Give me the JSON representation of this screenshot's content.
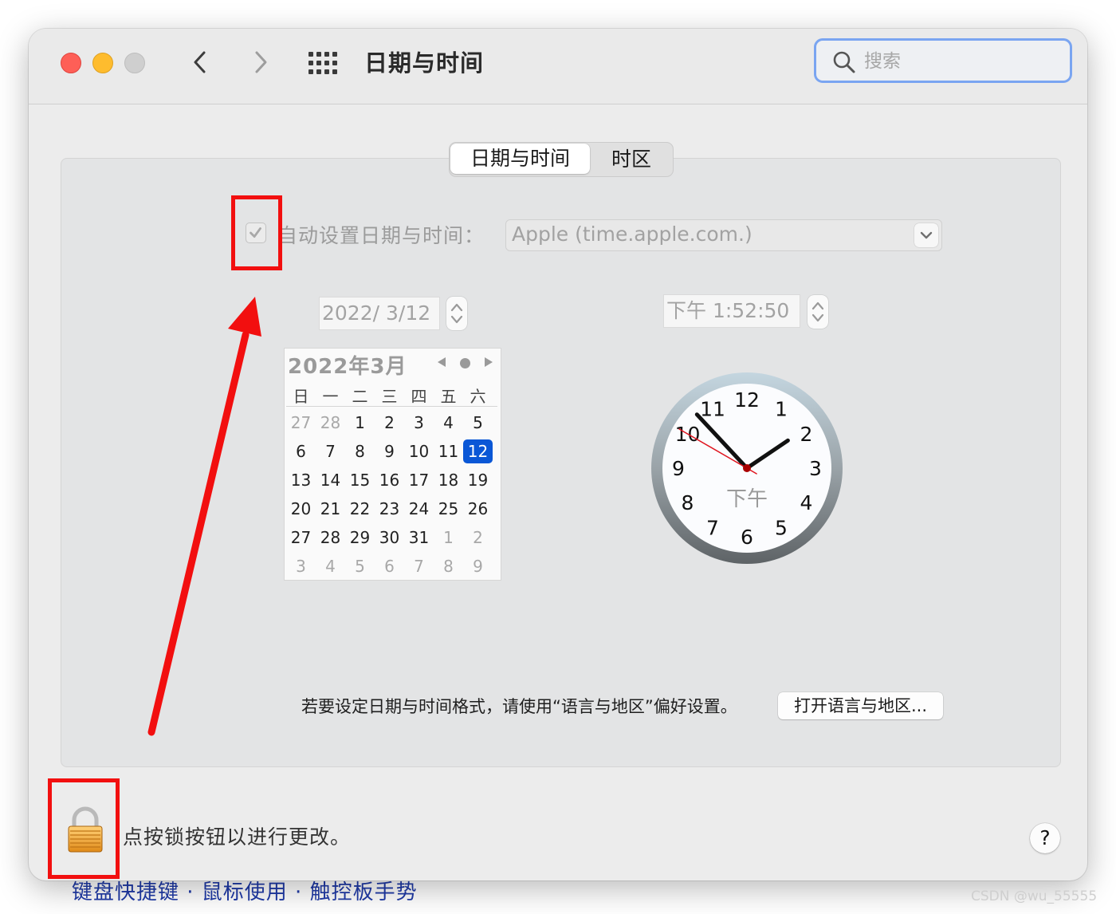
{
  "window": {
    "title": "日期与时间",
    "search_placeholder": "搜索"
  },
  "tabs": {
    "date_time": "日期与时间",
    "time_zone": "时区",
    "active": "日期与时间"
  },
  "auto": {
    "label": "自动设置日期与时间：",
    "checked": true,
    "server": "Apple (time.apple.com.)"
  },
  "date_field": {
    "value": "2022/  3/12"
  },
  "time_field": {
    "value": "下午   1:52:50"
  },
  "calendar": {
    "title": "2022年3月",
    "weekdays": [
      "日",
      "一",
      "二",
      "三",
      "四",
      "五",
      "六"
    ],
    "rows": [
      [
        {
          "d": "27",
          "m": true
        },
        {
          "d": "28",
          "m": true
        },
        {
          "d": "1"
        },
        {
          "d": "2"
        },
        {
          "d": "3"
        },
        {
          "d": "4"
        },
        {
          "d": "5"
        }
      ],
      [
        {
          "d": "6"
        },
        {
          "d": "7"
        },
        {
          "d": "8"
        },
        {
          "d": "9"
        },
        {
          "d": "10"
        },
        {
          "d": "11"
        },
        {
          "d": "12",
          "s": true
        }
      ],
      [
        {
          "d": "13"
        },
        {
          "d": "14"
        },
        {
          "d": "15"
        },
        {
          "d": "16"
        },
        {
          "d": "17"
        },
        {
          "d": "18"
        },
        {
          "d": "19"
        }
      ],
      [
        {
          "d": "20"
        },
        {
          "d": "21"
        },
        {
          "d": "22"
        },
        {
          "d": "23"
        },
        {
          "d": "24"
        },
        {
          "d": "25"
        },
        {
          "d": "26"
        }
      ],
      [
        {
          "d": "27"
        },
        {
          "d": "28"
        },
        {
          "d": "29"
        },
        {
          "d": "30"
        },
        {
          "d": "31"
        },
        {
          "d": "1",
          "m": true
        },
        {
          "d": "2",
          "m": true
        }
      ],
      [
        {
          "d": "3",
          "m": true
        },
        {
          "d": "4",
          "m": true
        },
        {
          "d": "5",
          "m": true
        },
        {
          "d": "6",
          "m": true
        },
        {
          "d": "7",
          "m": true
        },
        {
          "d": "8",
          "m": true
        },
        {
          "d": "9",
          "m": true
        }
      ]
    ]
  },
  "clock": {
    "numerals": [
      "12",
      "1",
      "2",
      "3",
      "4",
      "5",
      "6",
      "7",
      "8",
      "9",
      "10",
      "11"
    ],
    "period": "下午",
    "time": {
      "h": 1,
      "m": 52,
      "s": 50
    }
  },
  "format": {
    "text": "若要设定日期与时间格式，请使用“语言与地区”偏好设置。",
    "button": "打开语言与地区..."
  },
  "lock": {
    "text": "点按锁按钮以进行更改。"
  },
  "help": {
    "label": "?"
  },
  "background_text": "键盘快捷键 · 鼠标使用 · 触控板手势",
  "watermark": "CSDN @wu_55555",
  "colors": {
    "accent": "#0a57d6",
    "annotation": "#f20f0f",
    "search_ring": "#7aa5f1"
  }
}
